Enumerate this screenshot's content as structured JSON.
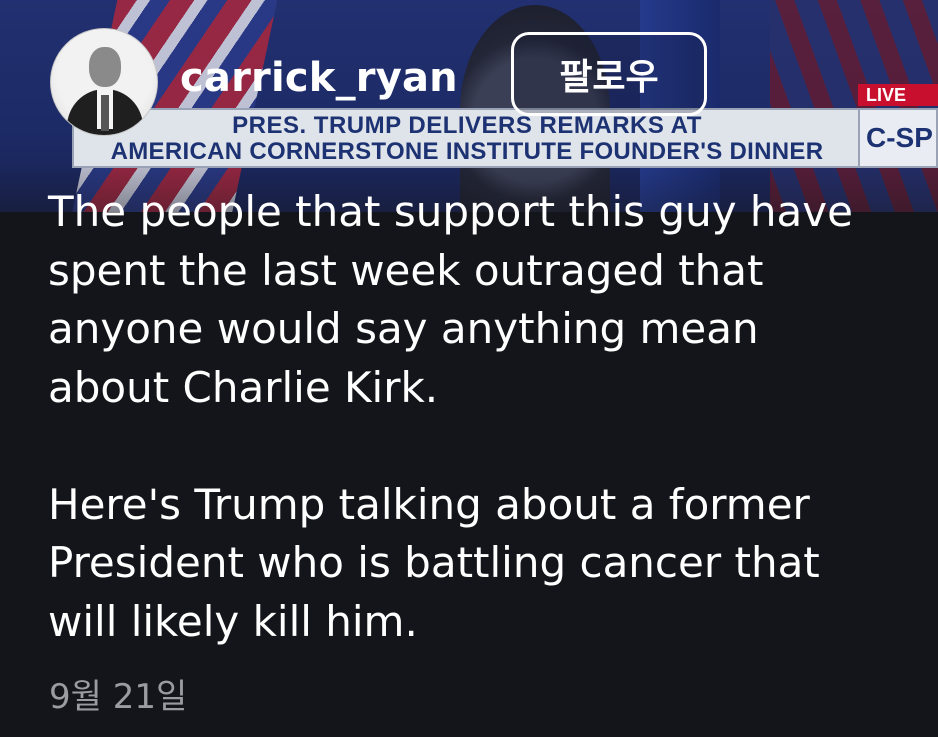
{
  "post": {
    "username": "carrick_ryan",
    "follow_label": "팔로우",
    "caption": "The people that support this guy have\nspent the last week outraged that\nanyone would say anything mean\nabout Charlie Kirk.\n\nHere's Trump talking about a former\nPresident who is battling cancer that\nwill likely kill him.",
    "date": "9월 21일"
  },
  "video_banner": {
    "line1": "PRES. TRUMP DELIVERS REMARKS AT",
    "line2": "AMERICAN CORNERSTONE INSTITUTE FOUNDER'S DINNER",
    "live": "LIVE",
    "network": "C-SP"
  },
  "colors": {
    "background": "#14151a",
    "text": "#ffffff",
    "date_text": "#9b9ba2",
    "banner_text": "#1d3272",
    "live_red": "#c8102e"
  }
}
